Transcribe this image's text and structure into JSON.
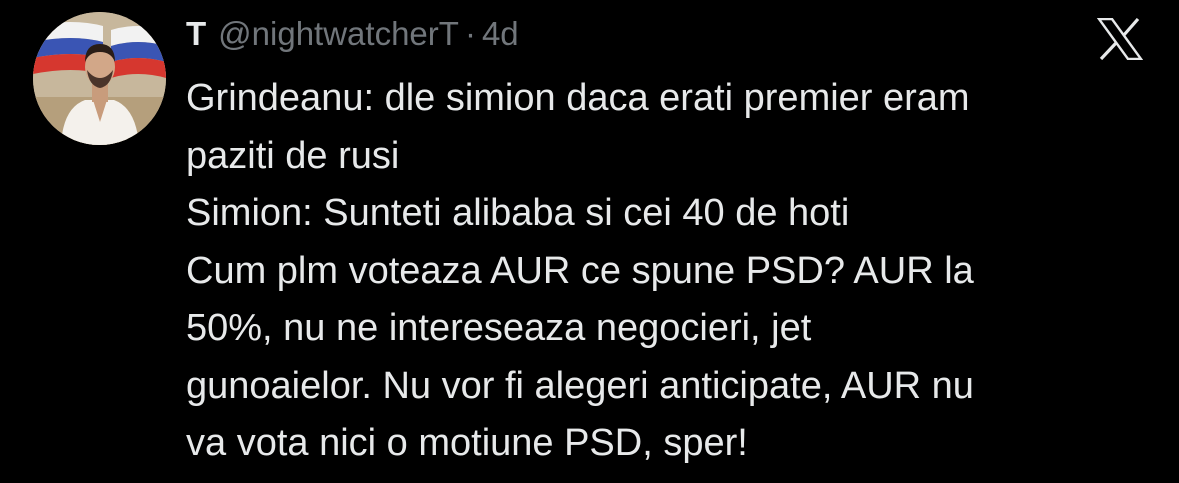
{
  "tweet": {
    "display_name": "T",
    "handle": "@nightwatcherT",
    "separator": "·",
    "time": "4d",
    "lines": [
      "Grindeanu: dle simion daca erati premier eram",
      "paziti de rusi",
      "Simion: Sunteti alibaba si cei 40 de hoti",
      "Cum plm voteaza AUR ce spune PSD? AUR la",
      "50%, nu ne intereseaza negocieri, jet",
      "gunoaielor. Nu vor fi alegeri anticipate, AUR nu",
      "va vota nici o motiune PSD, sper!"
    ]
  },
  "icons": {
    "avatar": "profile-photo-with-russian-flag",
    "logo": "x-logo-icon"
  },
  "colors": {
    "background": "#000000",
    "primary_text": "#e7e9ea",
    "secondary_text": "#71767b"
  }
}
